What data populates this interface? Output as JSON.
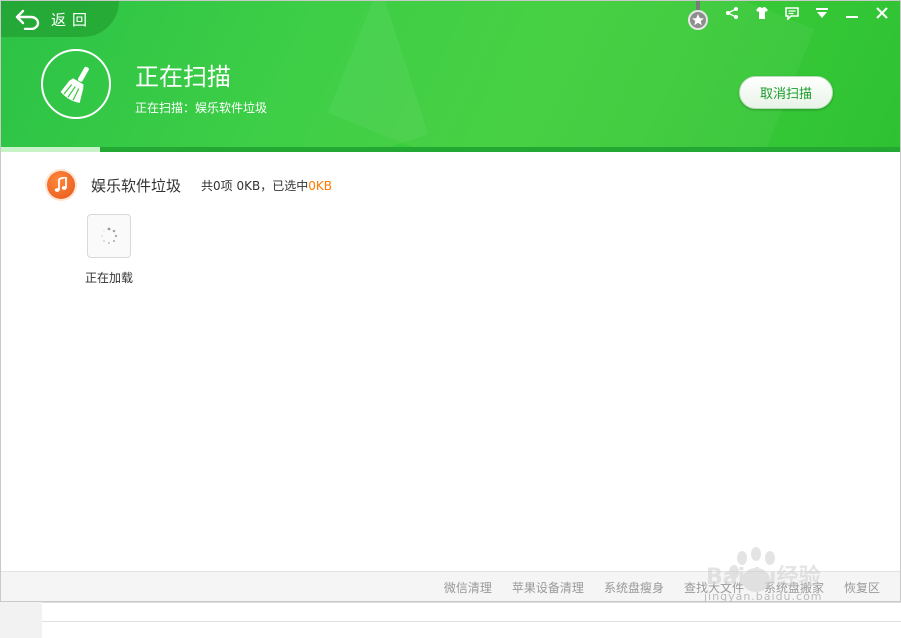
{
  "header": {
    "back_label": "返回",
    "title": "正在扫描",
    "subtitle": "正在扫描：娱乐软件垃圾",
    "cancel_label": "取消扫描",
    "progress": 0.11
  },
  "window_controls": [
    "share-icon",
    "skin-icon",
    "feedback-icon",
    "menu-icon",
    "minimize-icon",
    "close-icon"
  ],
  "category": {
    "name": "娱乐软件垃圾",
    "summary_prefix": "共0项 0KB，已选中",
    "selected": "0KB"
  },
  "loading": {
    "label": "正在加载"
  },
  "footer": {
    "links": [
      "微信清理",
      "苹果设备清理",
      "系统盘瘦身",
      "查找大文件",
      "系统盘搬家",
      "恢复区"
    ]
  },
  "watermark": {
    "logo": "Baidu经验",
    "url": "jingyan.baidu.com"
  },
  "colors": {
    "brand_green": "#33cc3c",
    "accent_orange": "#ff7a00"
  }
}
